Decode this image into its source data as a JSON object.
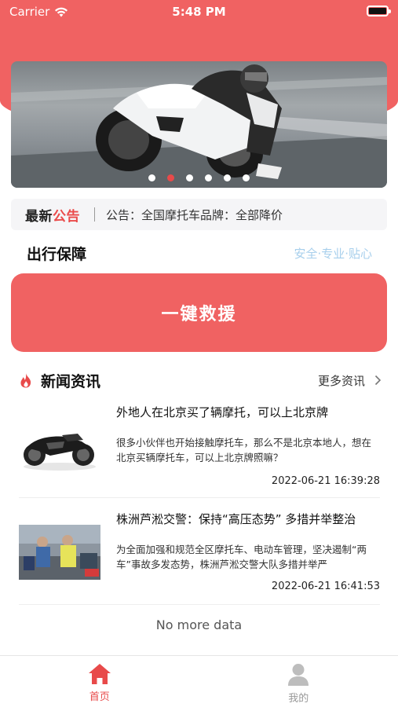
{
  "status_bar": {
    "carrier": "Carrier",
    "time": "5:48 PM"
  },
  "banner": {
    "slide_count": 6,
    "active_index": 1
  },
  "notice": {
    "brand_part1": "最新",
    "brand_part2": "公告",
    "text": "公告：全国摩托车品牌：全部降价"
  },
  "travel": {
    "title": "出行保障",
    "slogan": "安全·专业·贴心"
  },
  "rescue_button": {
    "label": "一键救援"
  },
  "news": {
    "title": "新闻资讯",
    "more_label": "更多资讯",
    "items": [
      {
        "headline": "外地人在北京买了辆摩托，可以上北京牌",
        "summary": "很多小伙伴也开始接触摩托车，那么不是北京本地人，想在北京买辆摩托车，可以上北京牌照嘛？",
        "date": "2022-06-21 16:39:28"
      },
      {
        "headline": "株洲芦淞交警：保持“高压态势” 多措并举整治",
        "summary": "为全面加强和规范全区摩托车、电动车管理，坚决遏制“两车”事故多发态势，株洲芦淞交警大队多措并举严",
        "date": "2022-06-21 16:41:53"
      }
    ],
    "footer": "No more data"
  },
  "tabbar": {
    "tabs": [
      {
        "label": "首页",
        "active": true
      },
      {
        "label": "我的",
        "active": false
      }
    ]
  },
  "colors": {
    "primary": "#f06262",
    "accent_text": "#ea4b4b",
    "slogan": "#a7cfec"
  }
}
